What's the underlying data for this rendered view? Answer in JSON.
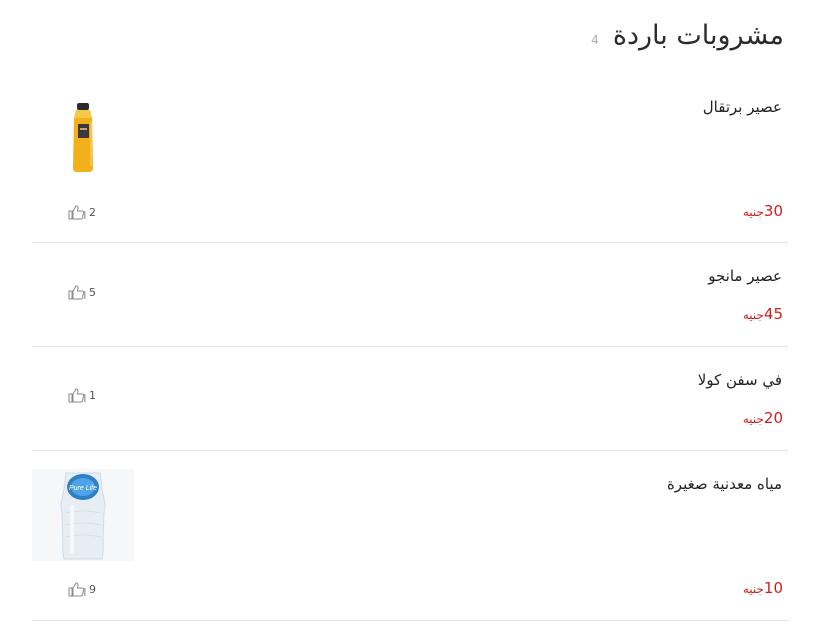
{
  "category": {
    "title": "مشروبات باردة",
    "count": "4"
  },
  "products": [
    {
      "name": "عصير برتقال",
      "price": "30",
      "currency": "جنيه",
      "likes": "2",
      "image": "orange-juice-bottle"
    },
    {
      "name": "عصير مانجو",
      "price": "45",
      "currency": "جنيه",
      "likes": "5"
    },
    {
      "name": "في سفن كولا",
      "price": "20",
      "currency": "جنيه",
      "likes": "1"
    },
    {
      "name": "مياه معدنية صغيرة",
      "price": "10",
      "currency": "جنيه",
      "likes": "9",
      "image": "water-bottle",
      "image_label": "Pure Life"
    }
  ],
  "colors": {
    "price": "#cc1f1f",
    "divider": "#e3e3e3",
    "count": "#aaaaaa"
  },
  "icons": {
    "like": "thumbs-up-icon"
  }
}
